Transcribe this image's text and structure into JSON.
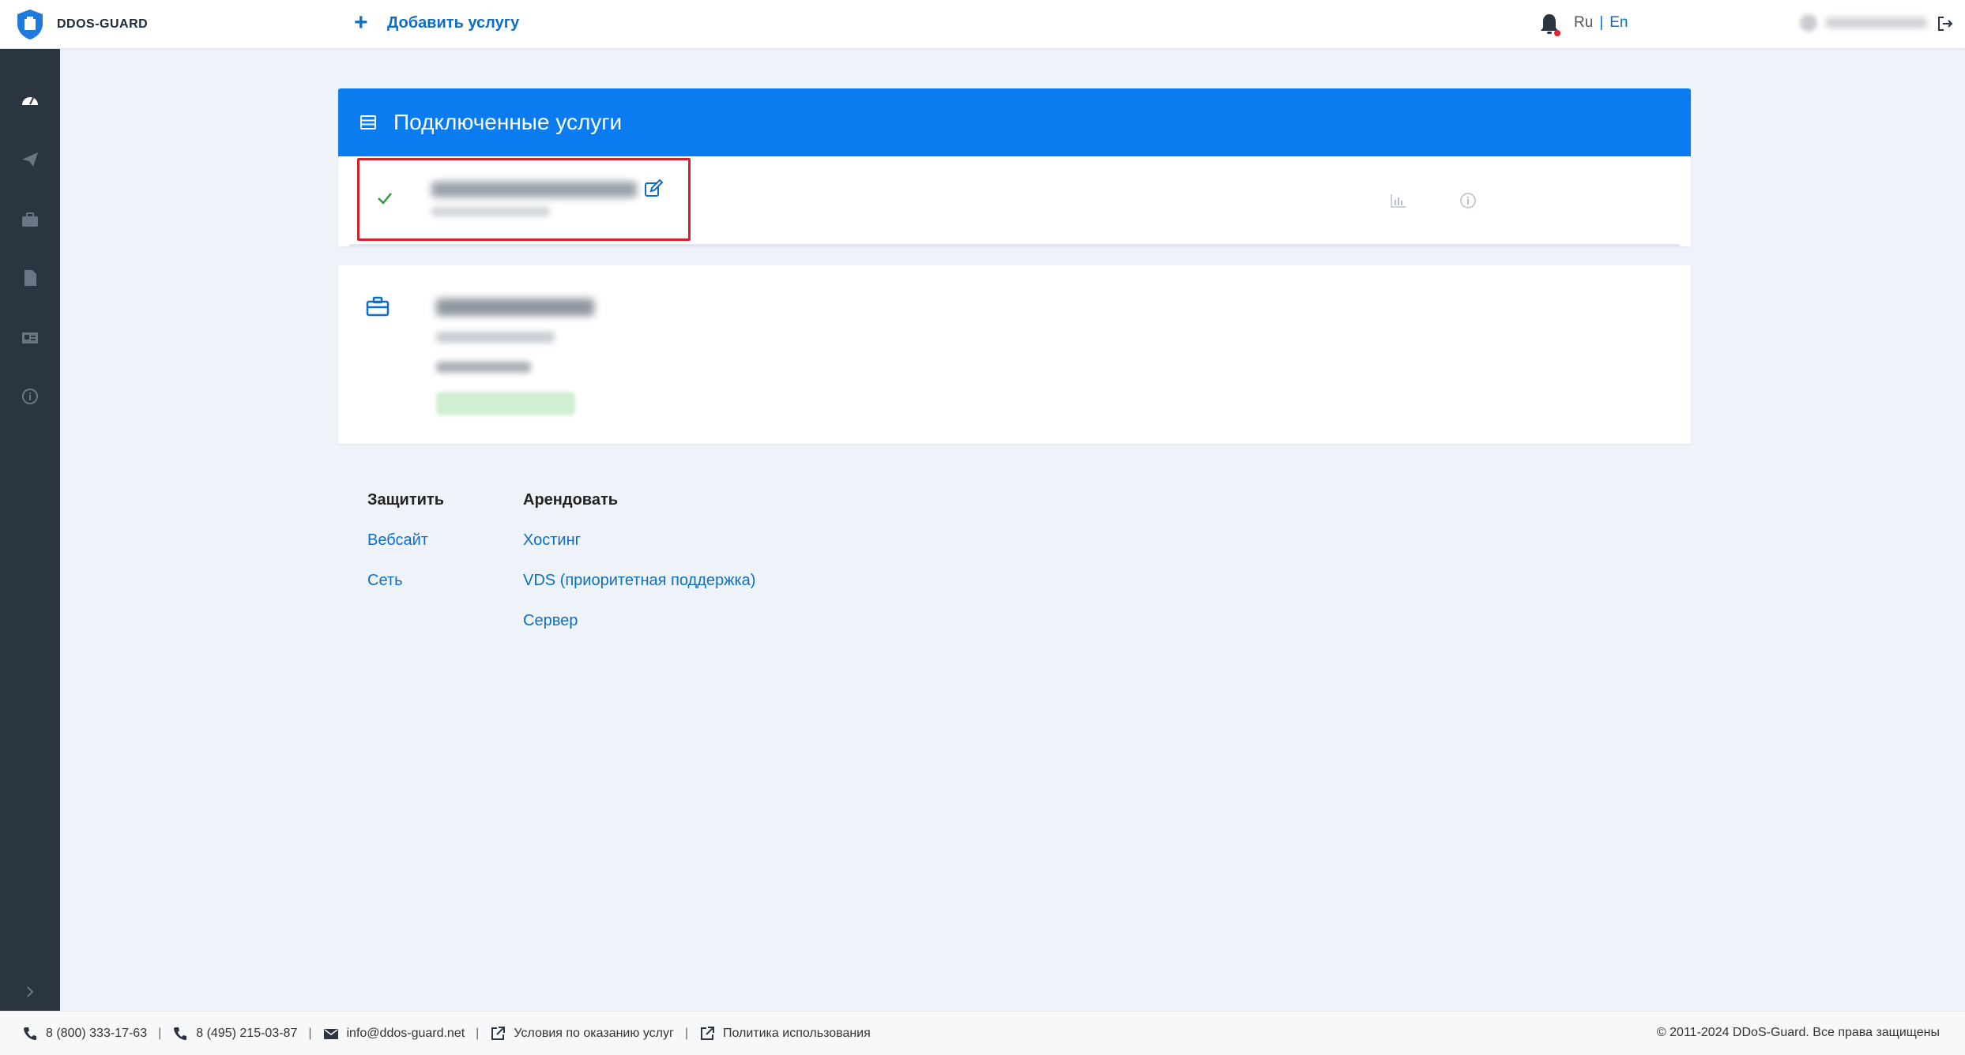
{
  "header": {
    "logo_text": "DDOS-GUARD",
    "add_service_label": "Добавить услугу",
    "lang_ru": "Ru",
    "lang_sep": "|",
    "lang_en": "En"
  },
  "sidebar": {
    "items": [
      "dashboard-icon",
      "send-icon",
      "briefcase-icon",
      "document-icon",
      "id-card-icon",
      "info-icon"
    ]
  },
  "services_card": {
    "title": "Подключенные услуги"
  },
  "links": {
    "protect": {
      "heading": "Защитить",
      "items": [
        "Вебсайт",
        "Сеть"
      ]
    },
    "rent": {
      "heading": "Арендовать",
      "items": [
        "Хостинг",
        "VDS (приоритетная поддержка)",
        "Сервер"
      ]
    }
  },
  "footer": {
    "phone1": "8 (800) 333-17-63",
    "phone2": "8 (495) 215-03-87",
    "email": "info@ddos-guard.net",
    "terms": "Условия по оказанию услуг",
    "policy": "Политика использования",
    "separator": "|",
    "copyright": "© 2011-2024 DDoS-Guard. Все права защищены"
  },
  "colors": {
    "accent": "#0a7cf0",
    "link": "#0d6ec7",
    "sidebar": "#2b3542",
    "highlight": "#d8202a",
    "success": "#2e9e3c"
  }
}
